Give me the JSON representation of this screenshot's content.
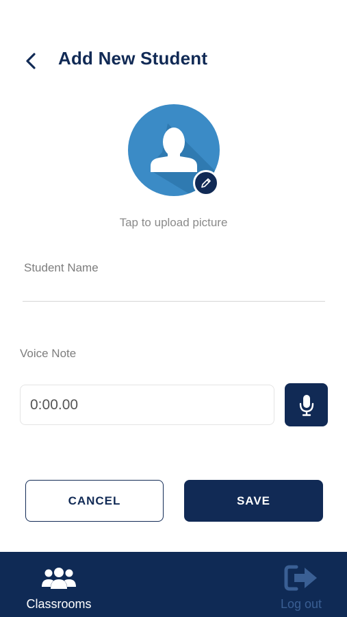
{
  "header": {
    "title": "Add New Student"
  },
  "avatar": {
    "upload_hint": "Tap to upload picture"
  },
  "form": {
    "student_name_label": "Student Name",
    "student_name_value": "",
    "voice_note_label": "Voice Note",
    "voice_note_time": "0:00.00"
  },
  "actions": {
    "cancel_label": "CANCEL",
    "save_label": "SAVE"
  },
  "bottom_nav": {
    "items": [
      {
        "label": "Classrooms",
        "icon": "people-icon",
        "active": true
      },
      {
        "label": "Log out",
        "icon": "logout-icon",
        "active": false
      }
    ]
  },
  "colors": {
    "primary": "#112a55",
    "avatar_bg": "#3b8bc6",
    "nav_bg": "#0f2a55",
    "inactive_nav": "#3a5f94",
    "muted_text": "#7d7d7d"
  }
}
